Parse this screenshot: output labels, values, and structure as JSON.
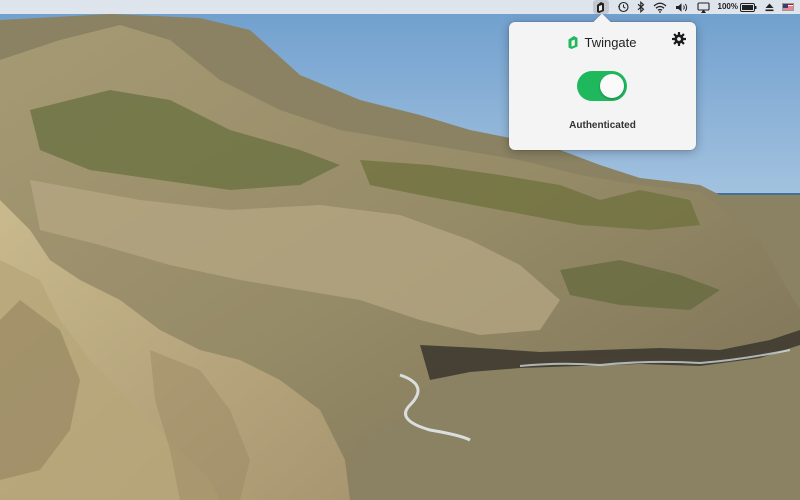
{
  "menubar": {
    "icons": [
      "twingate-icon",
      "time-machine-icon",
      "bluetooth-icon",
      "wifi-icon",
      "volume-icon",
      "airplay-icon",
      "battery-icon",
      "eject-icon",
      "us-flag-icon"
    ],
    "battery_percent": "100%"
  },
  "popover": {
    "app_name": "Twingate",
    "status": "Authenticated",
    "toggle_on": true,
    "colors": {
      "toggle_on": "#1fb85d",
      "logo": "#1fb85d"
    }
  }
}
